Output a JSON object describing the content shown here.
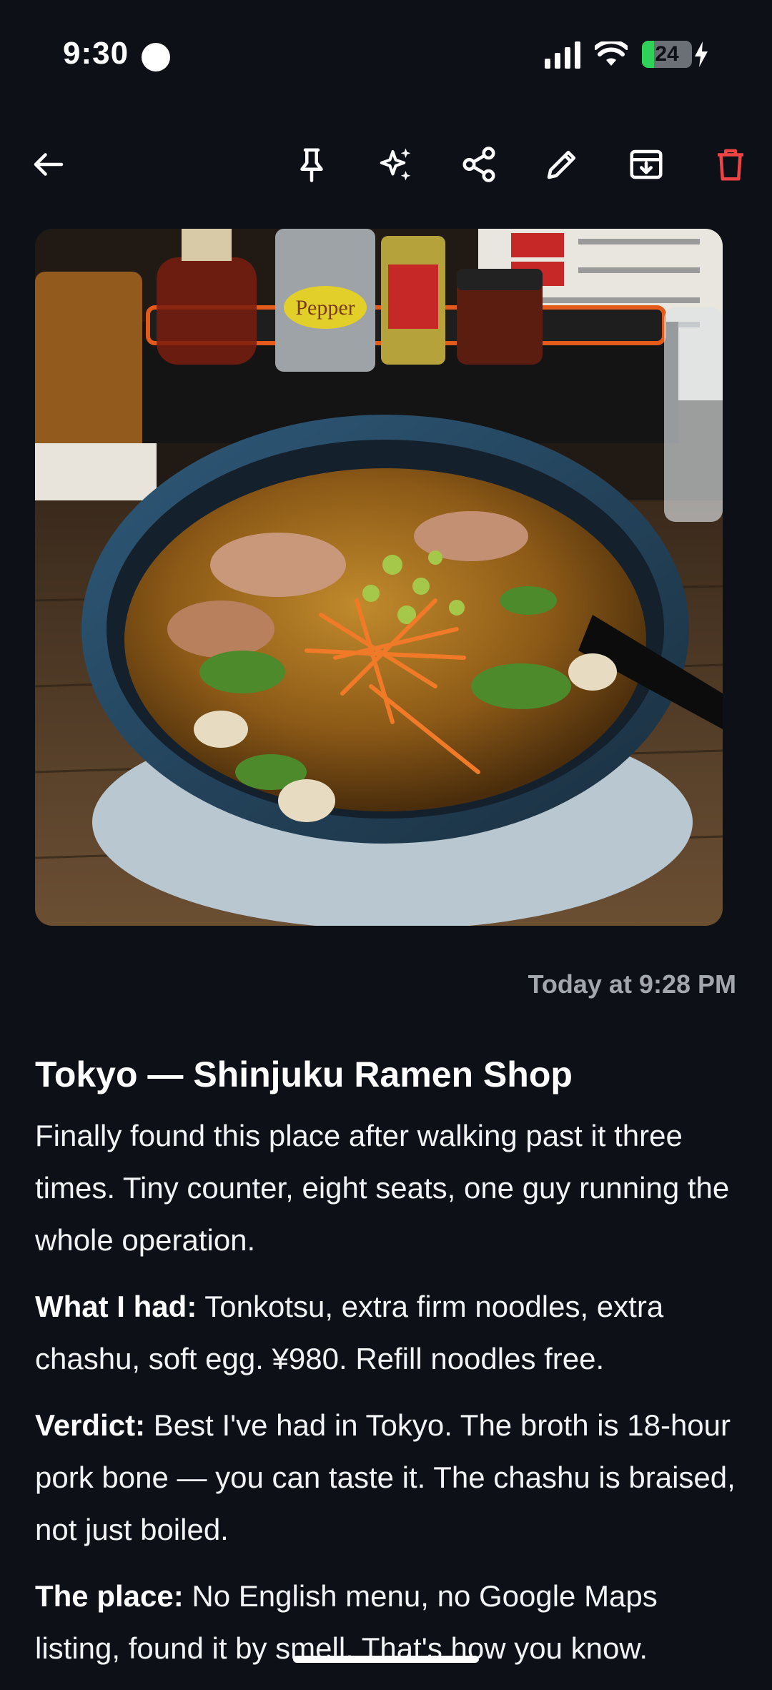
{
  "status_bar": {
    "time": "9:30",
    "battery_percent": "24",
    "battery_level": 0.24
  },
  "toolbar": {
    "icons": [
      "back-arrow-icon",
      "pin-icon",
      "sparkle-icon",
      "share-icon",
      "edit-icon",
      "archive-icon",
      "delete-icon"
    ],
    "delete_color": "#ef4444"
  },
  "note": {
    "timestamp": "Today at 9:28 PM",
    "title": "Tokyo — Shinjuku Ramen Shop",
    "intro": "Finally found this place after walking past it three times. Tiny counter, eight seats, one guy running the whole operation.",
    "sections": [
      {
        "label": "What I had:",
        "text": " Tonkotsu, extra firm noodles, extra chashu, soft egg. ¥980. Refill noodles free."
      },
      {
        "label": "Verdict:",
        "text": " Best I've had in Tokyo. The broth is 18-hour pork bone — you can taste it. The chashu is braised, not just boiled."
      },
      {
        "label": "The place:",
        "text": " No English menu, no Google Maps listing, found it by smell. That's how you know."
      }
    ]
  },
  "photo": {
    "condiment_label": "Pepper"
  }
}
